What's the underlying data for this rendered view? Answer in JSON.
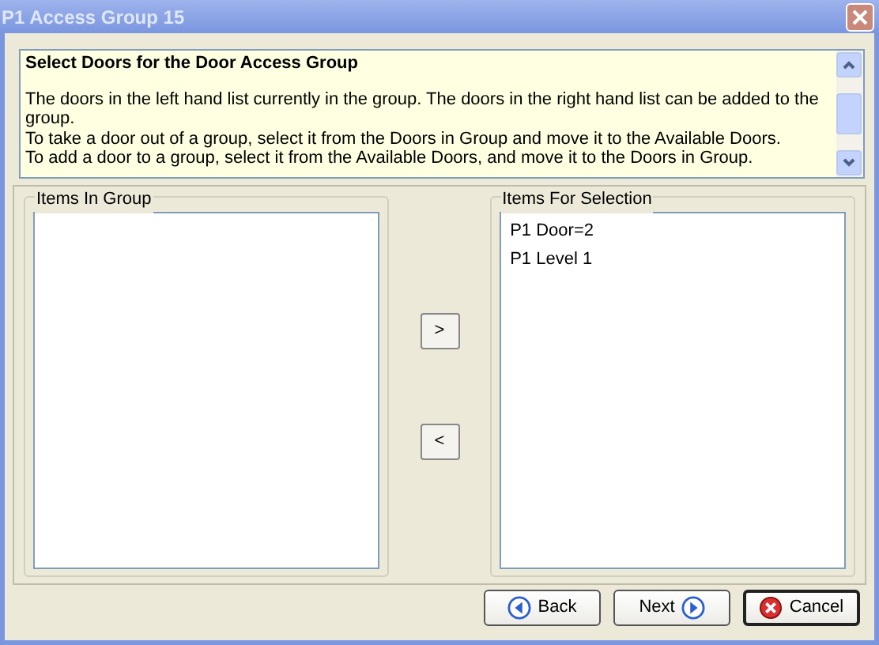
{
  "window": {
    "title": "P1 Access Group  15"
  },
  "info": {
    "heading": "Select Doors for the Door Access Group",
    "lines": [
      "The doors in the left hand list currently in the group. The doors in the right hand list can be added to the group.",
      "To take a door out of a group, select it from the Doors in Group and move it to the Available Doors.",
      "To add a door to a group, select it from the Available Doors, and move it to the Doors in Group."
    ]
  },
  "in_group": {
    "title": "Items In Group"
  },
  "move_buttons": [
    {
      "label": ">"
    },
    {
      "label": "<"
    }
  ],
  "for_selection": {
    "title": "Items For Selection",
    "items": [
      "P1 Door=2",
      "P1 Level 1"
    ]
  },
  "buttons": [
    {
      "kind": "back",
      "label": "Back"
    },
    {
      "kind": "next",
      "label": "Next"
    },
    {
      "kind": "cancel",
      "label": "Cancel"
    }
  ]
}
